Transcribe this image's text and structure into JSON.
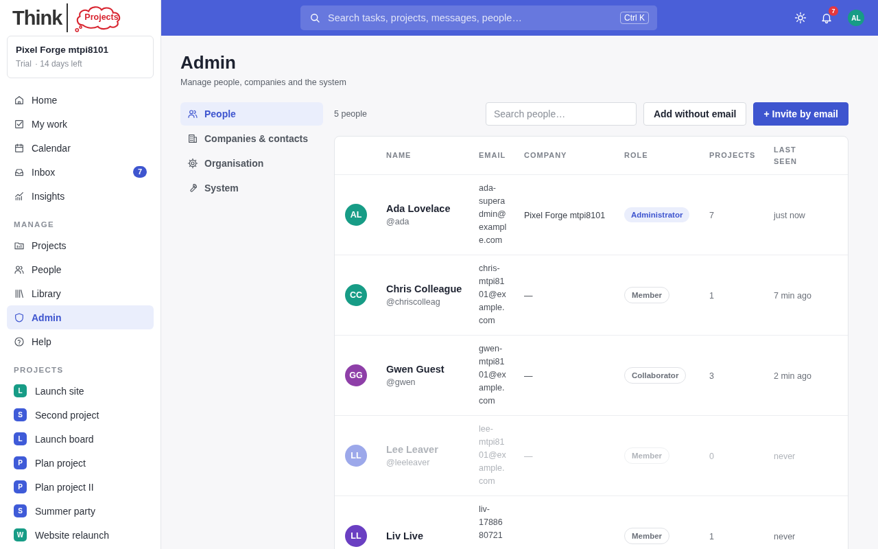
{
  "logo": {
    "word": "Think",
    "badge": "Projects"
  },
  "workspace": {
    "name": "Pixel Forge mtpi8101",
    "plan": "Trial",
    "remaining": "· 14 days left"
  },
  "nav": [
    {
      "kind": "home",
      "label": "Home",
      "selected": false
    },
    {
      "kind": "check",
      "label": "My work",
      "selected": false
    },
    {
      "kind": "calendar",
      "label": "Calendar",
      "selected": false
    },
    {
      "kind": "inbox",
      "label": "Inbox",
      "selected": false,
      "badge": "7"
    },
    {
      "kind": "chart",
      "label": "Insights",
      "selected": false
    }
  ],
  "manage": {
    "title": "MANAGE",
    "items": [
      {
        "kind": "folder",
        "label": "Projects",
        "selected": false
      },
      {
        "kind": "people",
        "label": "People",
        "selected": false
      },
      {
        "kind": "library",
        "label": "Library",
        "selected": false
      },
      {
        "kind": "shield",
        "label": "Admin",
        "selected": true
      },
      {
        "kind": "help",
        "label": "Help",
        "selected": false
      }
    ]
  },
  "projects": {
    "title": "PROJECTS",
    "items": [
      {
        "letter": "L",
        "label": "Launch site",
        "color": "#179c86"
      },
      {
        "letter": "S",
        "label": "Second project",
        "color": "#3f5bd8"
      },
      {
        "letter": "L",
        "label": "Launch board",
        "color": "#3f5bd8"
      },
      {
        "letter": "P",
        "label": "Plan project",
        "color": "#3f5bd8"
      },
      {
        "letter": "P",
        "label": "Plan project II",
        "color": "#3f5bd8"
      },
      {
        "letter": "S",
        "label": "Summer party",
        "color": "#3f5bd8"
      },
      {
        "letter": "W",
        "label": "Website relaunch",
        "color": "#179c86"
      }
    ]
  },
  "topbar": {
    "search_placeholder": "Search tasks, projects, messages, people…",
    "shortcut": "Ctrl K",
    "notifications": "7",
    "avatar": "AL"
  },
  "page": {
    "title": "Admin",
    "subtitle": "Manage people, companies and the system"
  },
  "admin_nav": [
    {
      "kind": "people",
      "label": "People",
      "selected": true
    },
    {
      "kind": "building",
      "label": "Companies & contacts",
      "selected": false
    },
    {
      "kind": "gear",
      "label": "Organisation",
      "selected": false
    },
    {
      "kind": "wrench",
      "label": "System",
      "selected": false
    }
  ],
  "toolbar": {
    "count": "5 people",
    "search_placeholder": "Search people…",
    "buttons": [
      {
        "kind": "secondary",
        "label": "Add without email"
      },
      {
        "kind": "primary",
        "label": "+ Invite by email"
      }
    ]
  },
  "table": {
    "columns": [
      "NAME",
      "EMAIL",
      "COMPANY",
      "ROLE",
      "PROJECTS",
      "LAST SEEN"
    ],
    "rows": [
      {
        "initials": "AL",
        "color": "#179c86",
        "name": "Ada Lovelace",
        "handle": "@ada",
        "email": "ada-superadmin@example.com",
        "company": "Pixel Forge mtpi8101",
        "role": "Administrator",
        "highlighted": true,
        "projects": "7",
        "last_seen": "just now",
        "inactive": false
      },
      {
        "initials": "CC",
        "color": "#179c86",
        "name": "Chris Colleague",
        "handle": "@chriscolleag",
        "email": "chris-mtpi8101@example.com",
        "company": "—",
        "role": "Member",
        "highlighted": false,
        "projects": "1",
        "last_seen": "7 min ago",
        "inactive": false
      },
      {
        "initials": "GG",
        "color": "#8e3fa8",
        "name": "Gwen Guest",
        "handle": "@gwen",
        "email": "gwen-mtpi8101@example.com",
        "company": "—",
        "role": "Collaborator",
        "highlighted": false,
        "projects": "3",
        "last_seen": "2 min ago",
        "inactive": false
      },
      {
        "initials": "LL",
        "color": "#9ca8ea",
        "name": "Lee Leaver",
        "handle": "@leeleaver",
        "email": "lee-mtpi8101@example.com",
        "company": "—",
        "role": "Member",
        "highlighted": false,
        "projects": "0",
        "last_seen": "never",
        "inactive": true
      },
      {
        "initials": "LL",
        "color": "#6a3fc2",
        "name": "Liv Live",
        "email": "liv-1788680721",
        "role": "Member",
        "highlighted": false,
        "projects": "1",
        "last_seen": "never",
        "inactive": false
      }
    ]
  }
}
